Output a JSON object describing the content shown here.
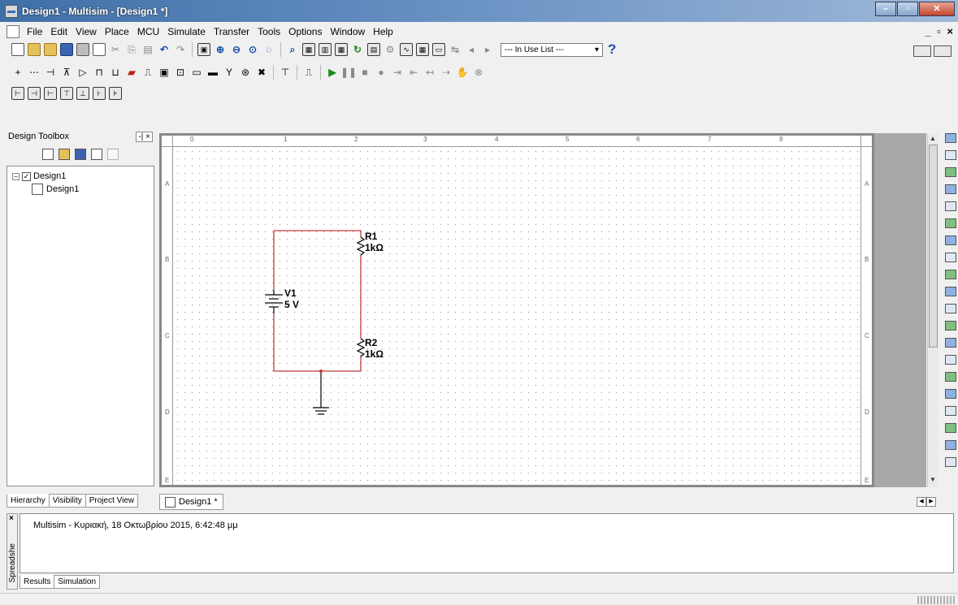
{
  "window": {
    "title": "Design1 - Multisim - [Design1 *]"
  },
  "menu": {
    "items": [
      "File",
      "Edit",
      "View",
      "Place",
      "MCU",
      "Simulate",
      "Transfer",
      "Tools",
      "Options",
      "Window",
      "Help"
    ],
    "mdi_controls": "_ ▫ ×"
  },
  "toolbar": {
    "in_use_list": "--- In Use List ---",
    "help_icon": "?"
  },
  "toolbox": {
    "title": "Design Toolbox",
    "tree": {
      "root": "Design1",
      "child": "Design1"
    },
    "tabs": [
      "Hierarchy",
      "Visibility",
      "Project View"
    ]
  },
  "workspace": {
    "ruler_top": [
      "0",
      "1",
      "2",
      "3",
      "4",
      "5",
      "6",
      "7",
      "8"
    ],
    "ruler_side": [
      "A",
      "B",
      "C",
      "D",
      "E"
    ],
    "doc_tab": "Design1 *"
  },
  "circuit": {
    "r1_name": "R1",
    "r1_value": "1kΩ",
    "r2_name": "R2",
    "r2_value": "1kΩ",
    "v1_name": "V1",
    "v1_value": "5 V",
    "wire_color": "#c43a3a"
  },
  "spreadsheet": {
    "side_label": "Spreadshe",
    "message": "Multisim  -  Κυριακή, 18 Οκτωβρίου 2015, 6:42:48 μμ",
    "tabs": [
      "Results",
      "Simulation"
    ]
  }
}
